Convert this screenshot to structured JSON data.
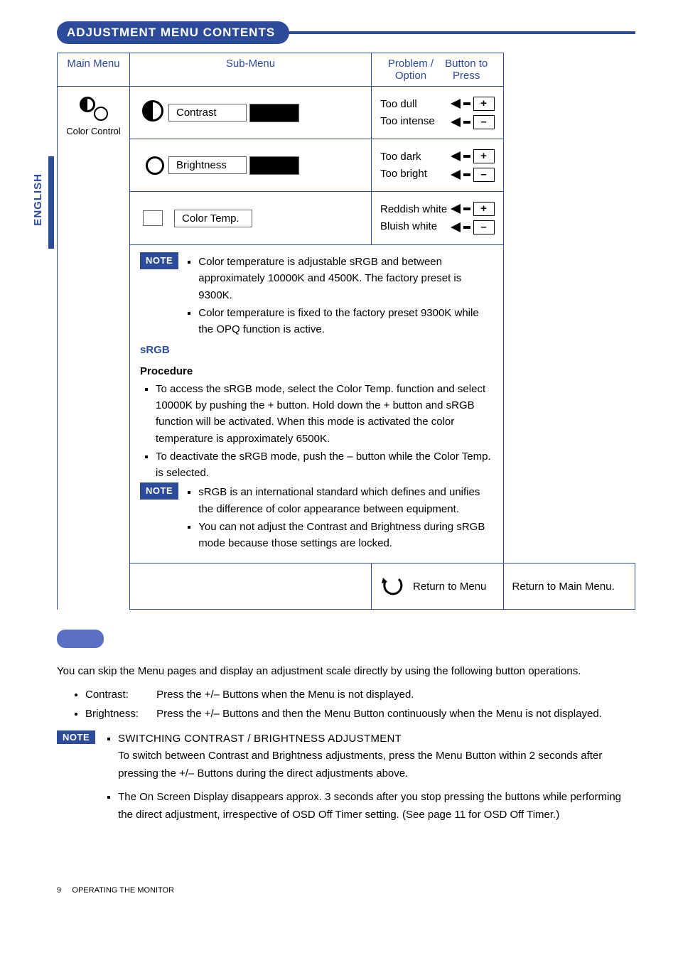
{
  "sideTab": "ENGLISH",
  "sectionTitle": "ADJUSTMENT MENU CONTENTS",
  "table": {
    "headers": {
      "main": "Main Menu",
      "sub": "Sub-Menu",
      "problem": "Problem / Option",
      "button": "Button to Press"
    },
    "mainMenu": {
      "label": "Color Control"
    },
    "rows": [
      {
        "sub": "Contrast",
        "problemA": "Too dull",
        "problemB": "Too intense"
      },
      {
        "sub": "Brightness",
        "problemA": "Too dark",
        "problemB": "Too bright"
      },
      {
        "sub": "Color Temp.",
        "problemA": "Reddish white",
        "problemB": "Bluish white"
      }
    ],
    "notes": {
      "note1a": "Color temperature is adjustable sRGB and between approximately 10000K and 4500K. The factory preset is 9300K.",
      "note1b": "Color temperature is fixed to the factory preset 9300K while the OPQ function is active.",
      "srgbLabel": "sRGB",
      "procLabel": "Procedure",
      "proc1": "To access the sRGB mode, select the Color Temp. function and select 10000K by pushing the + button. Hold down the + button and sRGB function will be activated. When this mode is activated the color temperature is approximately 6500K.",
      "proc2": "To deactivate the sRGB mode, push the – button while the Color Temp. is selected.",
      "note2a": "sRGB is an international standard which defines and unifies the difference of color appearance between equipment.",
      "note2b": "You can not adjust the Contrast and Brightness during sRGB mode because those settings are locked."
    },
    "returnRow": {
      "label": "Return to Menu",
      "desc": "Return to Main Menu."
    },
    "noteBadge": "NOTE"
  },
  "direct": {
    "intro": "You can skip the Menu pages and display an adjustment scale directly by using the following button operations.",
    "items": [
      {
        "label": "Contrast:",
        "text": "Press the +/– Buttons when the Menu is not displayed."
      },
      {
        "label": "Brightness:",
        "text": "Press the +/– Buttons and then the Menu Button continuously when the Menu is not displayed."
      }
    ],
    "notes": [
      {
        "heading": "SWITCHING CONTRAST / BRIGHTNESS ADJUSTMENT",
        "text": "To switch between Contrast and Brightness adjustments, press the Menu Button within 2 seconds after pressing the +/– Buttons during the direct adjustments above."
      },
      {
        "heading": "",
        "text": "The On Screen Display disappears approx. 3 seconds after you stop pressing the buttons while performing the direct adjustment, irrespective of OSD Off Timer setting. (See page 11 for OSD Off Timer.)"
      }
    ]
  },
  "footer": {
    "page": "9",
    "section": "OPERATING THE MONITOR"
  },
  "keys": {
    "plus": "+",
    "minus": "–"
  }
}
